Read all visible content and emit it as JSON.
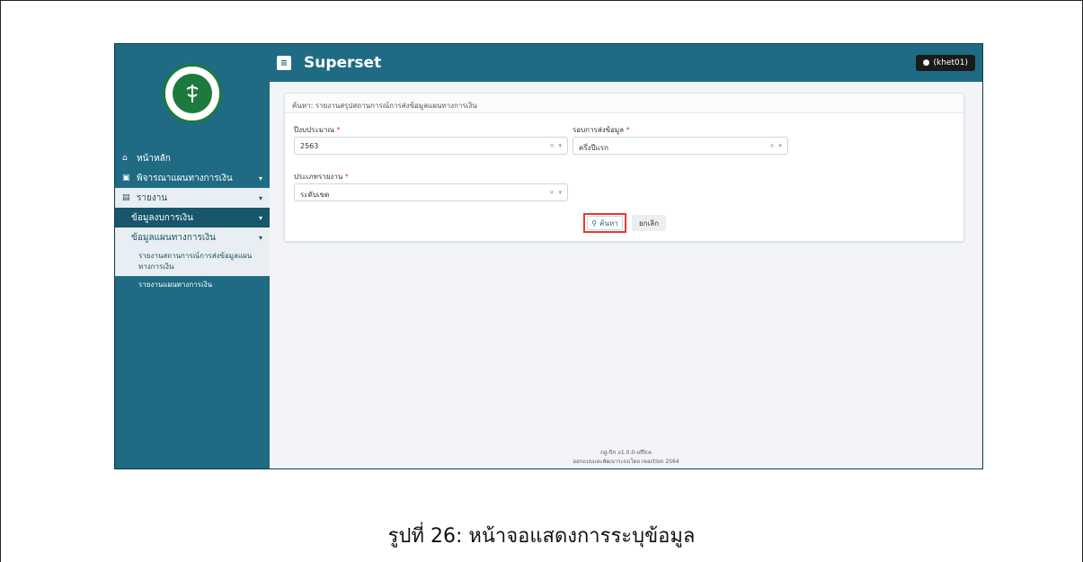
{
  "app": {
    "title": "Superset",
    "user": "(khet01)",
    "version": "ng-fin v1.0.0-office",
    "credit": "ออกแบบและพัฒนาระบบโดย reaction 2564"
  },
  "sidebar": {
    "items": [
      {
        "label": "หน้าหลัก",
        "icon": "home-icon"
      },
      {
        "label": "พิจารณาแผนทางการเงิน",
        "icon": "clipboard-icon"
      },
      {
        "label": "รายงาน",
        "icon": "file-icon"
      }
    ],
    "sub": [
      {
        "label": "ข้อมูลงบการเงิน"
      },
      {
        "label": "ข้อมูลแผนทางการเงิน"
      }
    ],
    "sub2": [
      {
        "label": "รายงานสถานการณ์การส่งข้อมูลแผนทางการเงิน"
      },
      {
        "label": "รายงานแผนทางการเงิน"
      }
    ]
  },
  "form": {
    "header": "ค้นหา: รายงานสรุปสถานการณ์การส่งข้อมูลแผนทางการเงิน",
    "year_label": "ปีงบประมาณ",
    "year_value": "2563",
    "round_label": "รอบการส่งข้อมูล",
    "round_value": "ครึ่งปีแรก",
    "type_label": "ประเภทรายงาน",
    "type_value": "ระดับเขต",
    "search_label": "ค้นหา",
    "cancel_label": "ยกเลิก",
    "required_mark": "*",
    "clear_mark": "×",
    "dropdown_mark": "▾"
  },
  "caption": "รูปที่ 26: หน้าจอแสดงการระบุข้อมูล",
  "colors": {
    "primary": "#1f6b84",
    "highlight": "#e53935"
  }
}
